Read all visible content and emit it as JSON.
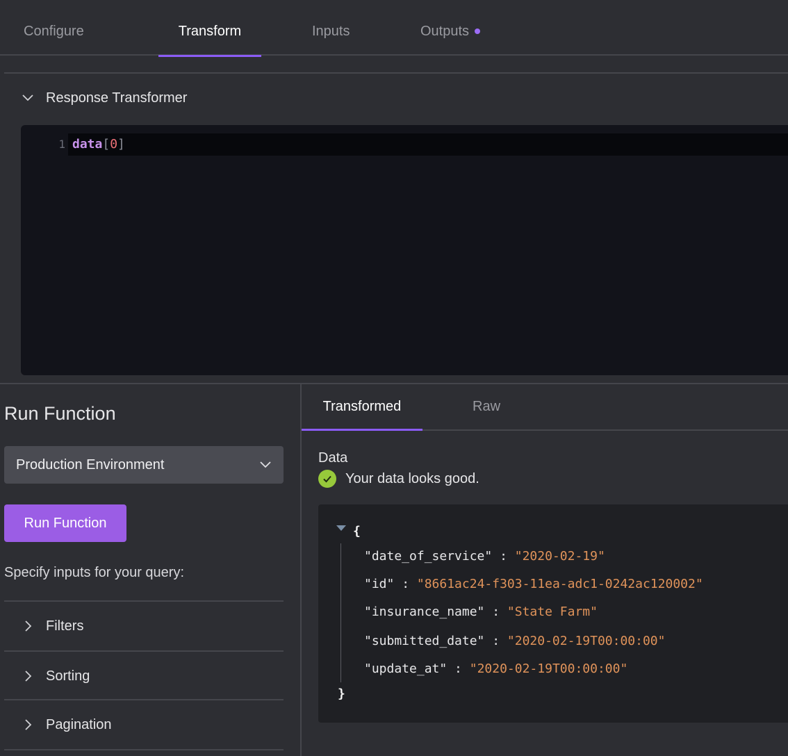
{
  "tabs": [
    {
      "label": "Configure"
    },
    {
      "label": "Transform"
    },
    {
      "label": "Inputs"
    },
    {
      "label": "Outputs"
    }
  ],
  "transformer": {
    "title": "Response Transformer",
    "line_number": "1",
    "code": {
      "ident": "data",
      "open": "[",
      "index": "0",
      "close": "]"
    }
  },
  "run": {
    "title": "Run Function",
    "environment": "Production Environment",
    "button_label": "Run Function",
    "hint": "Specify inputs for your query:",
    "sections": [
      {
        "label": "Filters"
      },
      {
        "label": "Sorting"
      },
      {
        "label": "Pagination"
      }
    ]
  },
  "result": {
    "tabs": [
      {
        "label": "Transformed"
      },
      {
        "label": "Raw"
      }
    ],
    "data_label": "Data",
    "status": "Your data looks good.",
    "json_open": "{",
    "json_close": "}",
    "fields": [
      {
        "key": "\"date_of_service\"",
        "value": "\"2020-02-19\""
      },
      {
        "key": "\"id\"",
        "value": "\"8661ac24-f303-11ea-adc1-0242ac120002\""
      },
      {
        "key": "\"insurance_name\"",
        "value": "\"State Farm\""
      },
      {
        "key": "\"submitted_date\"",
        "value": "\"2020-02-19T00:00:00\""
      },
      {
        "key": "\"update_at\"",
        "value": "\"2020-02-19T00:00:00\""
      }
    ]
  },
  "colors": {
    "accent": "#8b5cf6",
    "button": "#9b5de5",
    "success": "#97c93b",
    "string": "#e0935a"
  },
  "icons": [
    "chevron-down-icon",
    "chevron-right-icon",
    "check-circle-icon",
    "caret-down-icon",
    "status-dot-icon"
  ]
}
